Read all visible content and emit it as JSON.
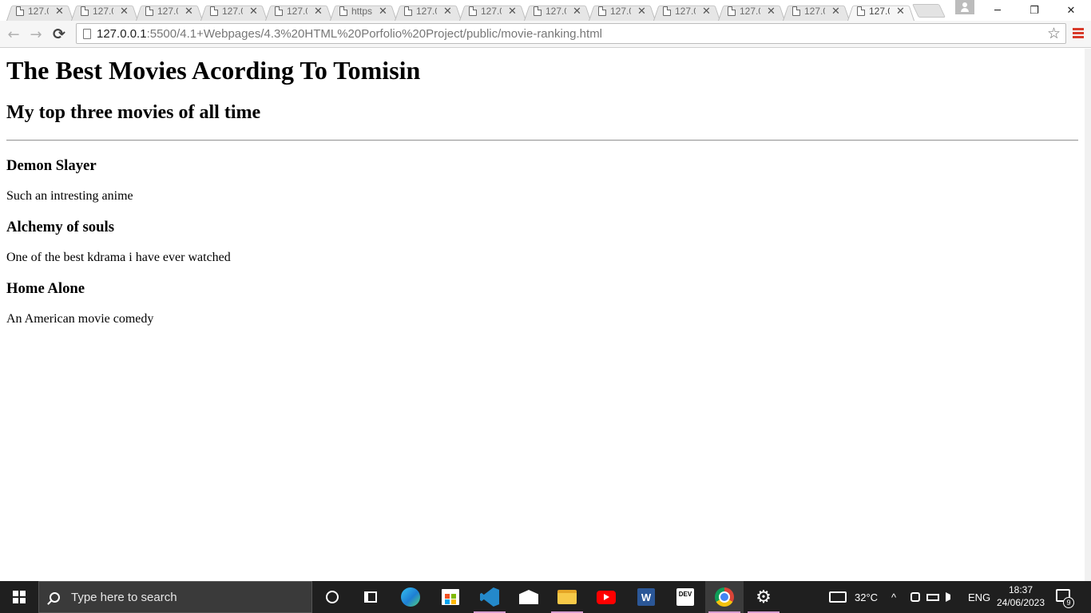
{
  "browser": {
    "tabs": [
      {
        "title": "127.0",
        "active": false
      },
      {
        "title": "127.0",
        "active": false
      },
      {
        "title": "127.0",
        "active": false
      },
      {
        "title": "127.0",
        "active": false
      },
      {
        "title": "127.0",
        "active": false
      },
      {
        "title": "https",
        "active": false
      },
      {
        "title": "127.0",
        "active": false
      },
      {
        "title": "127.0",
        "active": false
      },
      {
        "title": "127.0",
        "active": false
      },
      {
        "title": "127.0",
        "active": false
      },
      {
        "title": "127.0",
        "active": false
      },
      {
        "title": "127.0",
        "active": false
      },
      {
        "title": "127.0",
        "active": false
      },
      {
        "title": "127.0",
        "active": true
      }
    ],
    "tab_close_glyph": "✕",
    "window_controls": {
      "minimize": "─",
      "maximize": "❐",
      "close": "✕"
    },
    "toolbar": {
      "back_icon": "←",
      "forward_icon": "→",
      "reload_icon": "⟳",
      "url_host": "127.0.0.1",
      "url_rest": ":5500/4.1+Webpages/4.3%20HTML%20Porfolio%20Project/public/movie-ranking.html",
      "bookmark_icon": "☆"
    }
  },
  "page": {
    "title": "The Best Movies Acording To Tomisin",
    "subtitle": "My top three movies of all time",
    "movies": [
      {
        "name": "Demon Slayer",
        "description": "Such an intresting anime"
      },
      {
        "name": "Alchemy of souls",
        "description": "One of the best kdrama i have ever watched"
      },
      {
        "name": "Home Alone",
        "description": "An American movie comedy"
      }
    ]
  },
  "taskbar": {
    "search_placeholder": "Type here to search",
    "word_letter": "W",
    "dev_label": "DEV",
    "gear_glyph": "⚙",
    "weather": "32°C",
    "tray_chevron": "^",
    "language": "ENG",
    "time": "18:37",
    "date": "24/06/2023",
    "notification_count": "9",
    "colors": {
      "background": "#1f1f1f",
      "running_indicator": "#d59cd0"
    }
  }
}
